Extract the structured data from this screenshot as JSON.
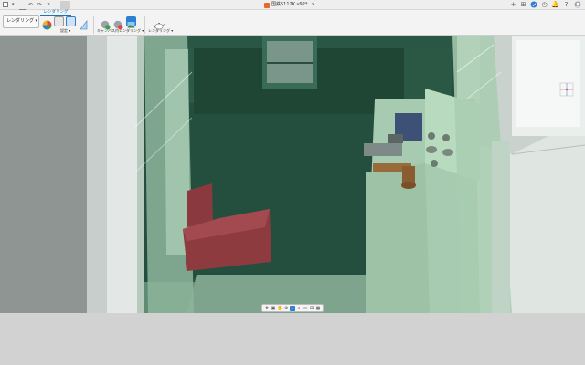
{
  "titlebar": {
    "document_title": "国鉄5112K v92*",
    "undo_icon": "undo-icon",
    "redo_icon": "redo-icon",
    "right_icons": [
      "add-tab-icon",
      "extensions-icon",
      "online-status-icon",
      "notifications-icon",
      "help-icon",
      "account-icon"
    ]
  },
  "ribbon": {
    "workspace_switch_label": "レンダリング ▾",
    "active_tab_label": "レンダリング",
    "groups": [
      {
        "label": "設定 ▾"
      },
      {
        "label": "キャンバス内レンダリング ▾"
      },
      {
        "label": "レンダリング ▾"
      }
    ]
  },
  "navigation_toolbar": {
    "buttons": [
      "orbit-icon",
      "look-at-icon",
      "pan-icon",
      "zoom-icon",
      "fit-icon",
      "display-settings-icon",
      "grid-icon",
      "viewports-icon"
    ]
  },
  "colors": {
    "accent": "#2d7fd0",
    "cab_wall": "#1f4a3a",
    "cab_light": "#b6d7bc",
    "seat": "#8f3b3f",
    "brake_handle": "#9a6b3a"
  }
}
